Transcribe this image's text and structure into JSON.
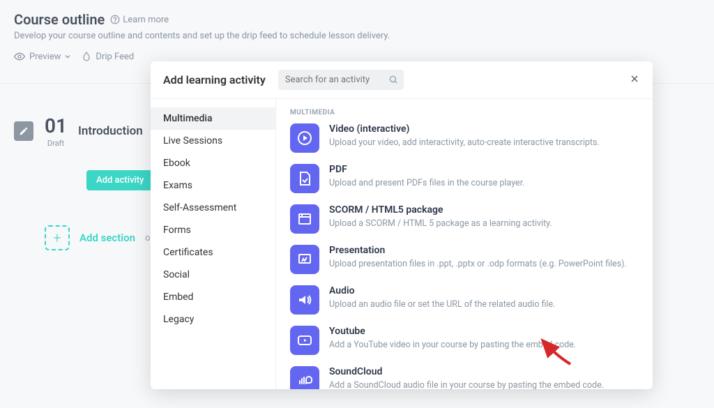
{
  "page": {
    "title": "Course outline",
    "learn_more": "Learn more",
    "subtitle": "Develop your course outline and contents and set up the drip feed to schedule lesson delivery.",
    "preview": "Preview",
    "drip_feed": "Drip Feed"
  },
  "section": {
    "number": "01",
    "status": "Draft",
    "name": "Introduction",
    "add_activity": "Add activity",
    "or": "or",
    "add_section": "Add section"
  },
  "modal": {
    "title": "Add learning activity",
    "search_placeholder": "Search for an activity",
    "sidebar": [
      "Multimedia",
      "Live Sessions",
      "Ebook",
      "Exams",
      "Self-Assessment",
      "Forms",
      "Certificates",
      "Social",
      "Embed",
      "Legacy"
    ],
    "section_label": "MULTIMEDIA",
    "activities": [
      {
        "icon": "play",
        "title": "Video (interactive)",
        "desc": "Upload your video, add interactivity, auto-create interactive transcripts."
      },
      {
        "icon": "pdf",
        "title": "PDF",
        "desc": "Upload and present PDFs files in the course player."
      },
      {
        "icon": "scorm",
        "title": "SCORM / HTML5 package",
        "desc": "Upload a SCORM / HTML 5 package as a learning activity."
      },
      {
        "icon": "pres",
        "title": "Presentation",
        "desc": "Upload presentation files in .ppt, .pptx or .odp formats (e.g. PowerPoint files)."
      },
      {
        "icon": "audio",
        "title": "Audio",
        "desc": "Upload an audio file or set the URL of the related audio file."
      },
      {
        "icon": "yt",
        "title": "Youtube",
        "desc": "Add a YouTube video in your course by pasting the embed code."
      },
      {
        "icon": "sc",
        "title": "SoundCloud",
        "desc": "Add a SoundCloud audio file in your course by pasting the embed code."
      }
    ]
  }
}
